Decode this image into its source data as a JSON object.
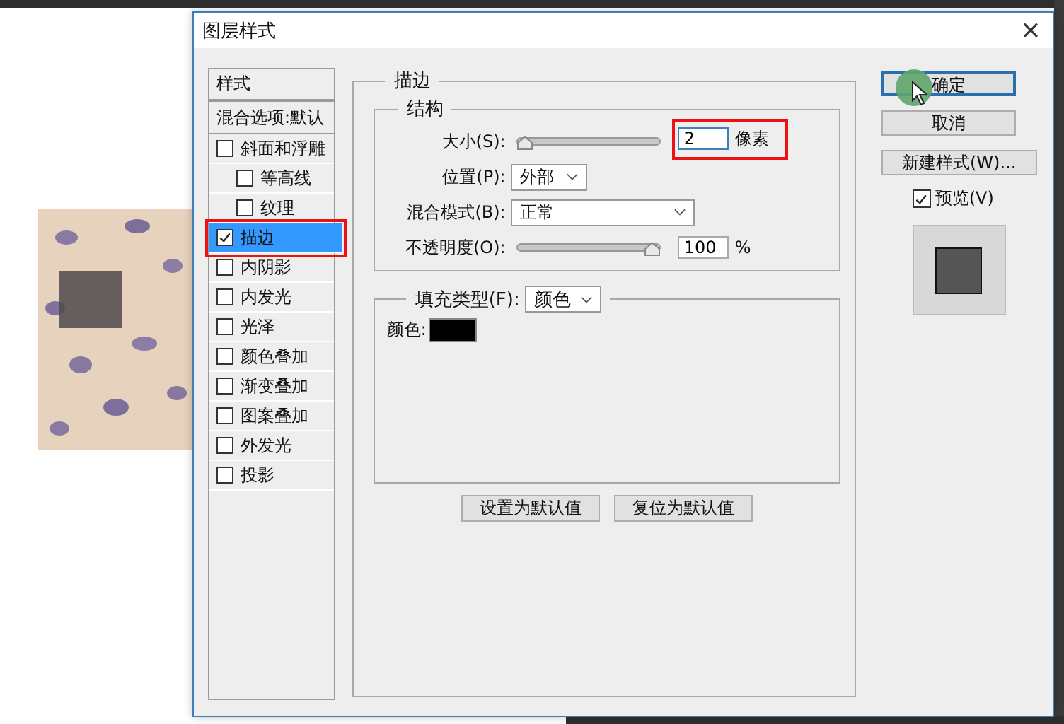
{
  "window": {
    "title": "图层样式",
    "close": "×"
  },
  "style_list": [
    {
      "label": "样式",
      "kind": "header"
    },
    {
      "label": "混合选项:默认",
      "kind": "plain",
      "selected": false
    },
    {
      "label": "斜面和浮雕",
      "kind": "check",
      "checked": false,
      "selected": false,
      "highlighted": false,
      "children": [
        {
          "label": "等高线",
          "kind": "check",
          "checked": false,
          "selected": false,
          "highlighted": false
        },
        {
          "label": "纹理",
          "kind": "check",
          "checked": false,
          "selected": false,
          "highlighted": false
        }
      ]
    },
    {
      "label": "描边",
      "kind": "check",
      "checked": true,
      "selected": true,
      "highlighted": true
    },
    {
      "label": "内阴影",
      "kind": "check",
      "checked": false,
      "selected": false,
      "highlighted": false
    },
    {
      "label": "内发光",
      "kind": "check",
      "checked": false,
      "selected": false,
      "highlighted": false
    },
    {
      "label": "光泽",
      "kind": "check",
      "checked": false,
      "selected": false,
      "highlighted": false
    },
    {
      "label": "颜色叠加",
      "kind": "check",
      "checked": false,
      "selected": false,
      "highlighted": false
    },
    {
      "label": "渐变叠加",
      "kind": "check",
      "checked": false,
      "selected": false,
      "highlighted": false
    },
    {
      "label": "图案叠加",
      "kind": "check",
      "checked": false,
      "selected": false,
      "highlighted": false
    },
    {
      "label": "外发光",
      "kind": "check",
      "checked": false,
      "selected": false,
      "highlighted": false
    },
    {
      "label": "投影",
      "kind": "check",
      "checked": false,
      "selected": false,
      "highlighted": false
    }
  ],
  "panel": {
    "title": "描边",
    "structure": {
      "title": "结构",
      "rows": [
        {
          "kind": "slider",
          "label": "大小(S):",
          "level": 0.0,
          "value": "2",
          "unit": "像素",
          "focused": true,
          "highlighted": true
        },
        {
          "kind": "select",
          "label": "位置(P):",
          "value": "外部",
          "wide": false
        },
        {
          "kind": "select",
          "label": "混合模式(B):",
          "value": "正常",
          "wide": true
        },
        {
          "kind": "slider",
          "label": "不透明度(O):",
          "level": 1.0,
          "value": "100",
          "unit": "%",
          "focused": false,
          "highlighted": false
        }
      ]
    },
    "fill": {
      "label": "填充类型(F):",
      "value": "颜色",
      "color_label": "颜色:",
      "color": "#000000"
    },
    "buttons": [
      "设置为默认值",
      "复位为默认值"
    ]
  },
  "side_buttons": [
    {
      "label": "确定",
      "default": true
    },
    {
      "label": "取消",
      "default": false
    },
    {
      "label": "新建样式(W)...",
      "default": false
    }
  ],
  "preview": {
    "label": "预览(V)",
    "checked": true
  }
}
